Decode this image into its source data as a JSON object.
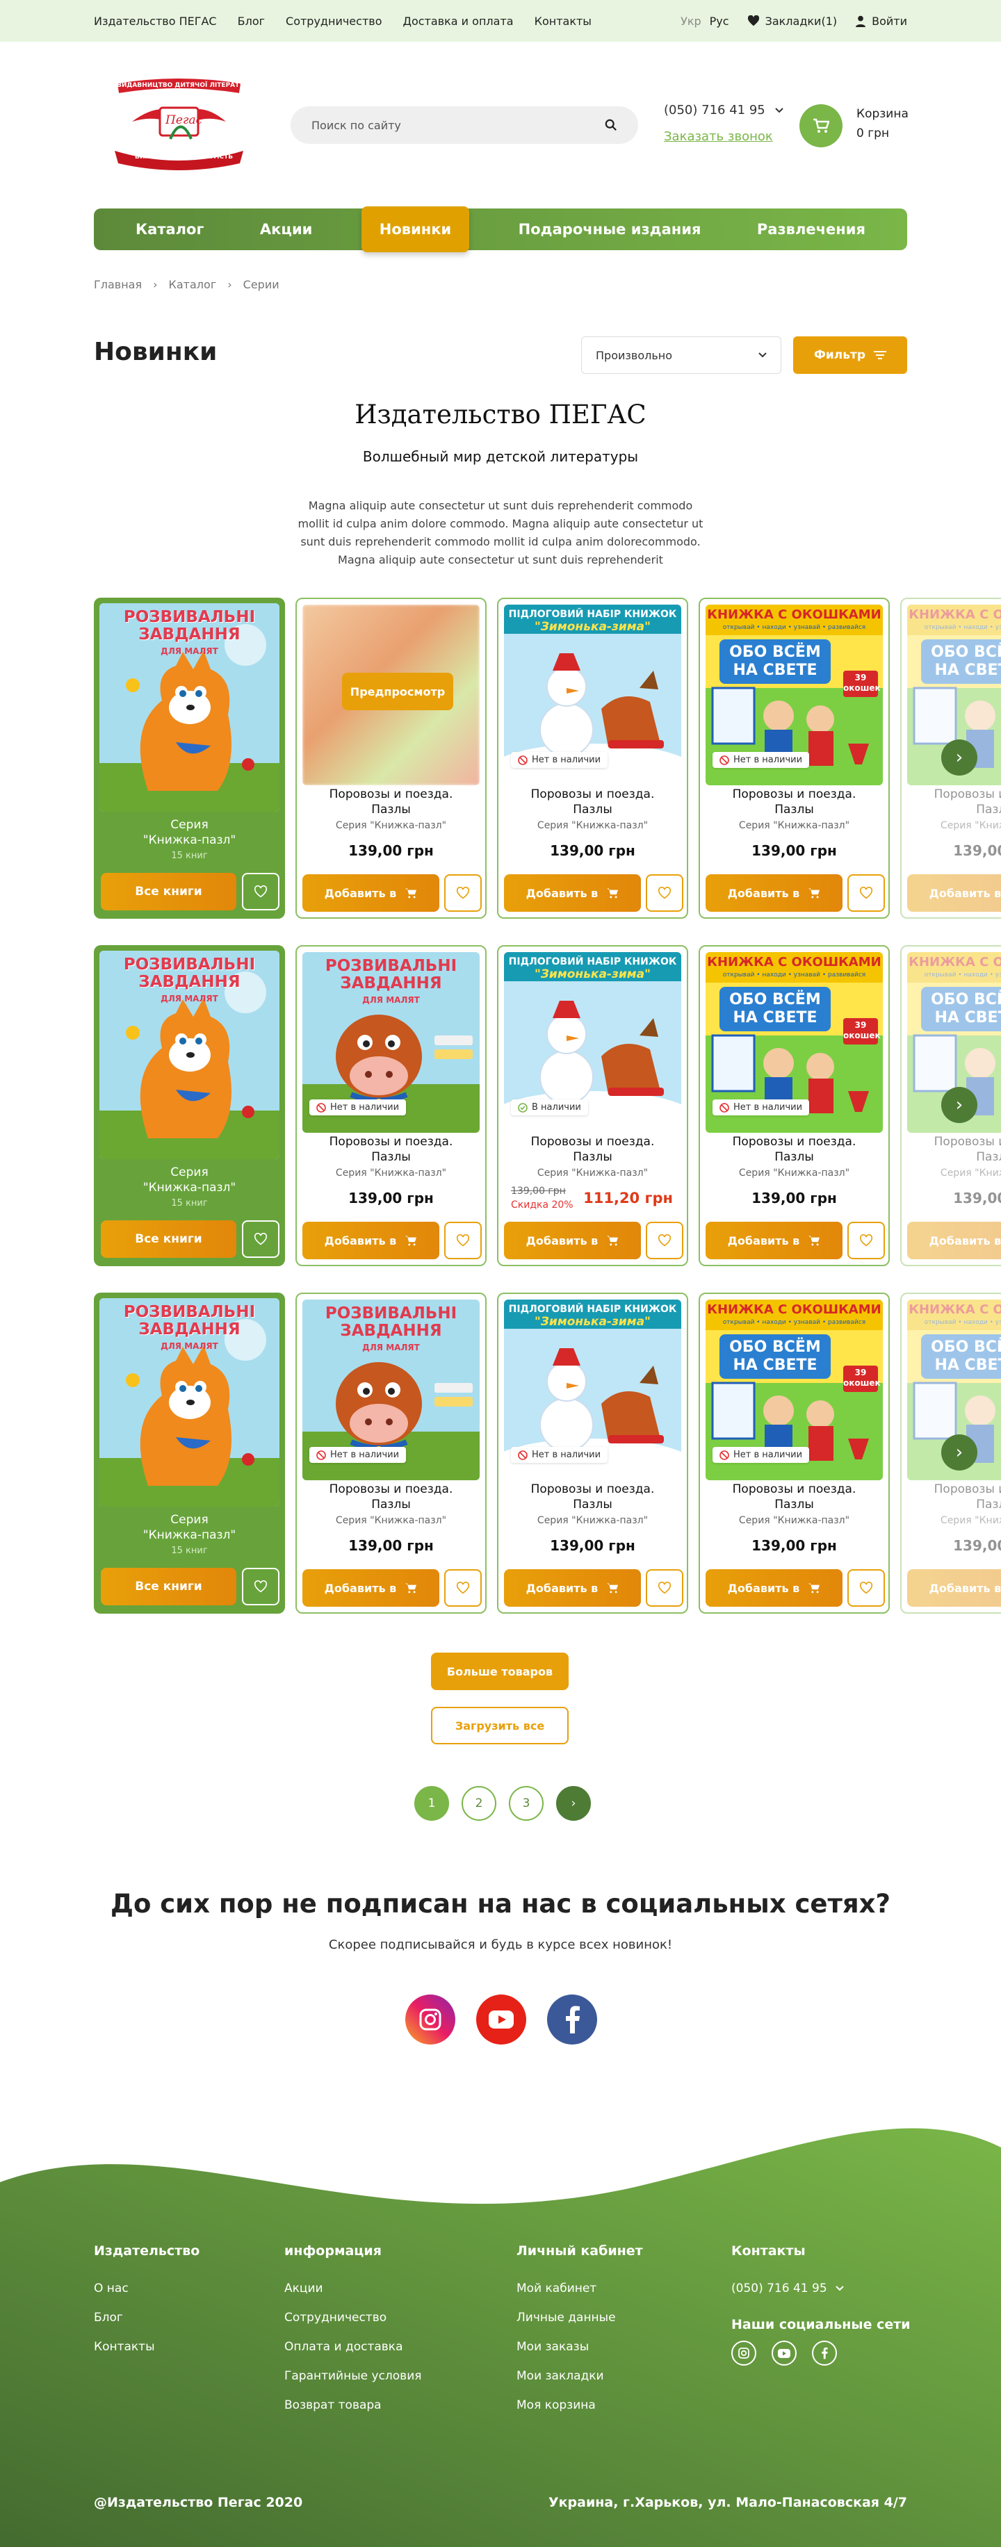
{
  "topbar": {
    "links": [
      "Издательство ПЕГАС",
      "Блог",
      "Сотрудничество",
      "Доставка и оплата",
      "Контакты"
    ],
    "lang_ukr": "Укр",
    "lang_rus": "Рус",
    "bookmarks": "Закладки(1)",
    "login": "Войти"
  },
  "header": {
    "logo_text_top": "ВИДАВНИЦТВО ДИТЯЧОЇ ЛІТЕРАТУРИ",
    "logo_brand": "Пегас",
    "logo_text_bottom": "ВИХОВУЄМО ОСОБИСТІСТЬ",
    "search_placeholder": "Поиск по сайту",
    "phone": "(050) 716 41 95",
    "callback": "Заказать звонок",
    "cart_label": "Корзина",
    "cart_sum": "0 грн"
  },
  "nav": [
    "Каталог",
    "Акции",
    "Новинки",
    "Подарочные издания",
    "Развлечения"
  ],
  "breadcrumbs": [
    "Главная",
    "Каталог",
    "Серии"
  ],
  "page": {
    "title": "Новинки",
    "sort": "Произвольно",
    "filter": "Фильтр",
    "pub_title": "Издательство ПЕГАС",
    "pub_sub": "Волшебный мир детской литературы",
    "pub_desc": "Magna aliquip aute consectetur ut sunt duis reprehenderit commodo mollit id culpa anim dolore commodo. Magna aliquip aute consectetur ut sunt duis reprehenderit commodo mollit id culpa anim dolorecommodo. Magna aliquip aute consectetur ut sunt duis reprehenderit"
  },
  "series": {
    "name_line1": "Серия",
    "name_line2": "\"Книжка-пазл\"",
    "count": "15 книг",
    "all_books": "Все книги",
    "cover_title": "РОЗВИВАЛЬНІ ЗАВДАННЯ",
    "cover_sub": "ДЛЯ МАЛЯТ"
  },
  "product": {
    "name_line1": "Поровозы и поезда.",
    "name_line2": "Пазлы",
    "series": "Серия \"Книжка-пазл\"",
    "price": "139,00 грн",
    "add": "Добавить в",
    "out": "Нет в наличии",
    "in": "В наличии",
    "preview": "Предпросмотр",
    "old_price": "139,00 грн",
    "discount": "Скидка 20%",
    "new_price": "111,20 грн",
    "cover_winter_top": "ПІДЛОГОВИЙ НАБІР КНИЖОК",
    "cover_winter_title": "\"Зимонька-зима\"",
    "cover_window_top": "КНИЖКА С ОКОШКАМИ",
    "cover_window_sub": "открывай • находи • узнавай • развивайся",
    "cover_window_title": "ОБО ВСЁМ НА СВЕТЕ",
    "cover_window_badge": "39 окошек"
  },
  "buttons": {
    "more": "Больше товаров",
    "load_all": "Загрузить все"
  },
  "pagination": [
    "1",
    "2",
    "3"
  ],
  "social": {
    "title": "До сих пор не подписан на нас в социальных сетях?",
    "subtitle": "Скорее подписывайся и будь в курсе всех новинок!"
  },
  "footer": {
    "col1": {
      "title": "Издательство",
      "links": [
        "О нас",
        "Блог",
        "Контакты"
      ]
    },
    "col2": {
      "title": "информация",
      "links": [
        "Акции",
        "Сотрудничество",
        "Оплата и доставка",
        "Гарантийные условия",
        "Возврат товара"
      ]
    },
    "col3": {
      "title": "Личный кабинет",
      "links": [
        "Мой кабинет",
        "Личные данные",
        "Мои заказы",
        "Мои закладки",
        "Моя корзина"
      ]
    },
    "col4": {
      "title": "Контакты",
      "phone": "(050) 716 41 95",
      "social_title": "Наши социальные сети"
    },
    "copyright": "@Издательство Пегас 2020",
    "address": "Украина,  г.Харьков, ул. Мало-Панасовская 4/7"
  },
  "colors": {
    "green": "#7ab648",
    "dark_green": "#4e7c35",
    "orange": "#e8a00a",
    "light_bg": "#e8f4df"
  }
}
